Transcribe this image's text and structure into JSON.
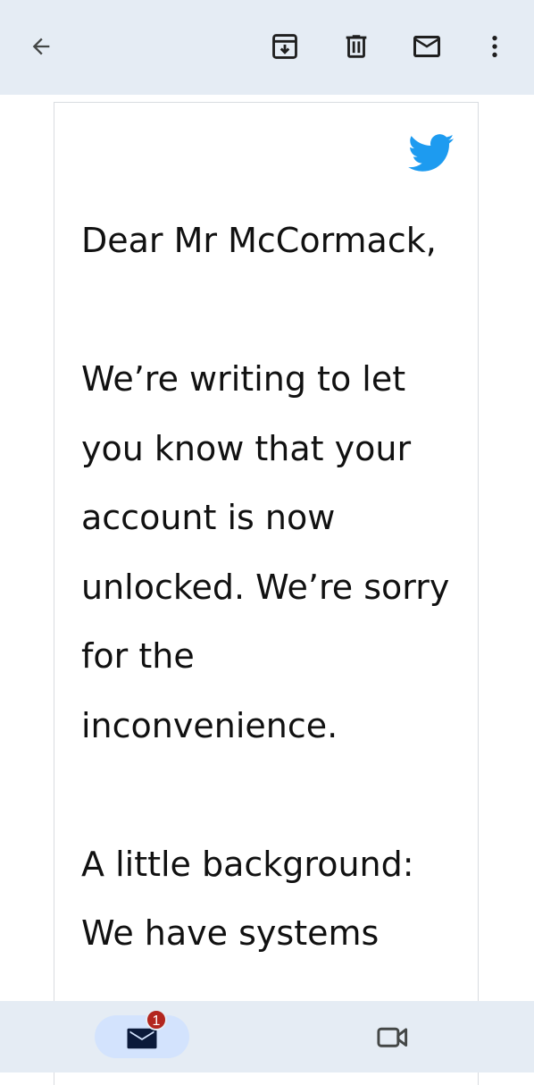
{
  "toolbar": {
    "back_icon": "arrow-back-icon",
    "archive_icon": "archive-icon",
    "delete_icon": "trash-icon",
    "mark_unread_icon": "mail-icon",
    "more_icon": "more-vert-icon"
  },
  "email": {
    "brand_icon": "twitter-bird-icon",
    "brand_color": "#1d9bf0",
    "paragraphs": [
      "Dear Mr McCormack,",
      "We’re writing to let you know that your account is now unlocked. We’re sorry for the inconvenience.",
      "A little background: We have systems"
    ]
  },
  "bottom_nav": {
    "mail_icon": "mail-icon",
    "unread_badge": "1",
    "badge_color": "#b3261e",
    "meet_icon": "video-camera-icon"
  },
  "colors": {
    "bar_background": "#e5ecf4",
    "active_tab": "#d3e3fd"
  }
}
